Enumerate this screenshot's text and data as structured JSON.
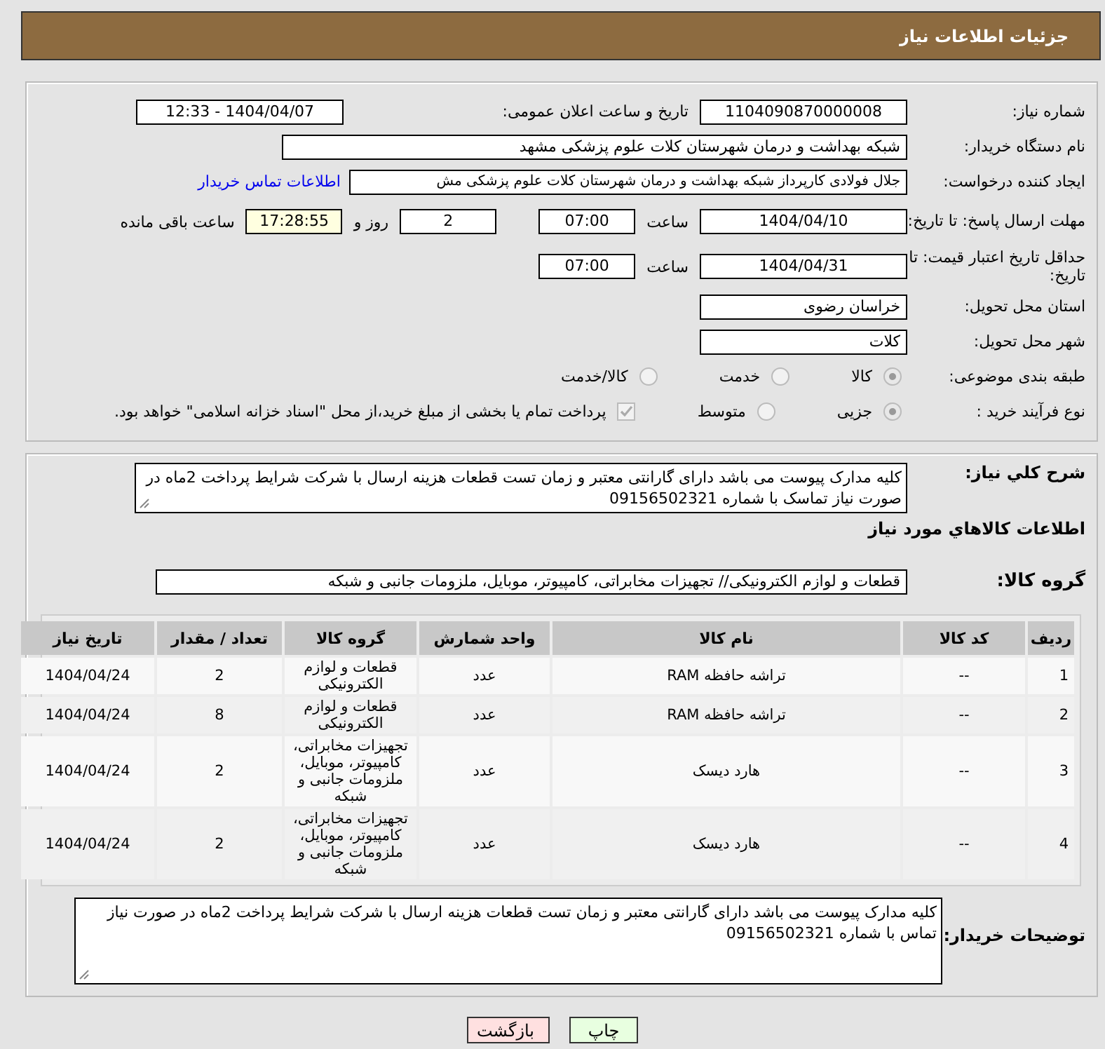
{
  "header": {
    "title": "جزئیات اطلاعات نیاز"
  },
  "fields": {
    "need_number": {
      "label": "شماره نیاز:",
      "value": "1104090870000008"
    },
    "announce": {
      "label": "تاریخ و ساعت اعلان عمومی:",
      "value": "1404/04/07 - 12:33"
    },
    "buyer": {
      "label": "نام دستگاه خریدار:",
      "value": "شبکه بهداشت و درمان شهرستان کلات   علوم پزشکی مشهد"
    },
    "creator": {
      "label": "ایجاد کننده درخواست:",
      "value": "جلال فولادی کارپرداز شبکه بهداشت و درمان شهرستان کلات   علوم پزشکی مش",
      "link": "اطلاعات تماس خریدار"
    },
    "deadline": {
      "label": "مهلت ارسال پاسخ: تا تاریخ:",
      "date": "1404/04/10",
      "time_label": "ساعت",
      "time": "07:00",
      "days": "2",
      "days_label": "روز و",
      "remaining": "17:28:55",
      "remaining_label": "ساعت باقی مانده"
    },
    "validity": {
      "label": "حداقل تاریخ اعتبار قیمت: تا تاریخ:",
      "date": "1404/04/31",
      "time_label": "ساعت",
      "time": "07:00"
    },
    "province": {
      "label": "استان محل تحویل:",
      "value": "خراسان رضوی"
    },
    "city": {
      "label": "شهر محل تحویل:",
      "value": "کلات"
    },
    "category": {
      "label": "طبقه بندی موضوعی:",
      "options": [
        {
          "label": "کالا",
          "selected": true
        },
        {
          "label": "خدمت",
          "selected": false
        },
        {
          "label": "کالا/خدمت",
          "selected": false
        }
      ]
    },
    "purchase": {
      "label": "نوع فرآیند خرید :",
      "options": [
        {
          "label": "جزیی",
          "selected": true
        },
        {
          "label": "متوسط",
          "selected": false
        }
      ],
      "note": {
        "checked": true,
        "text": "پرداخت تمام یا بخشی از مبلغ خرید،از محل \"اسناد خزانه اسلامی\" خواهد بود."
      }
    }
  },
  "description": {
    "label": "شرح کلي نياز:",
    "value": "کلیه مدارک پیوست می باشد دارای گارانتی معتبر و زمان تست قطعات هزینه ارسال با شرکت شرایط پرداخت 2ماه در صورت نیاز تماسک با شماره 09156502321"
  },
  "goods": {
    "title": "اطلاعات کالاهاي مورد نياز",
    "group_label": "گروه کالا:",
    "group": "قطعات و لوازم الکترونیکی// تجهیزات مخابراتی، کامپیوتر، موبایل، ملزومات جانبی و شبکه"
  },
  "table": {
    "columns": [
      "ردیف",
      "کد کالا",
      "نام کالا",
      "واحد شمارش",
      "گروه کالا",
      "تعداد / مقدار",
      "تاریخ نیاز"
    ],
    "rows": [
      [
        "1",
        "--",
        "تراشه حافظه RAM",
        "عدد",
        "قطعات و لوازم الکترونیکی",
        "2",
        "1404/04/24"
      ],
      [
        "2",
        "--",
        "تراشه حافظه RAM",
        "عدد",
        "قطعات و لوازم الکترونیکی",
        "8",
        "1404/04/24"
      ],
      [
        "3",
        "--",
        "هارد دیسک",
        "عدد",
        "تجهیزات مخابراتی، کامپیوتر، موبایل، ملزومات جانبی و شبکه",
        "2",
        "1404/04/24"
      ],
      [
        "4",
        "--",
        "هارد دیسک",
        "عدد",
        "تجهیزات مخابراتی، کامپیوتر، موبایل، ملزومات جانبی و شبکه",
        "2",
        "1404/04/24"
      ]
    ]
  },
  "buyer_notes": {
    "label": "توضیحات خریدار:",
    "value": "کلیه مدارک پیوست می باشد دارای گارانتی معتبر و زمان تست قطعات هزینه ارسال با شرکت شرایط پرداخت 2ماه در صورت نیاز تماس با شماره 09156502321"
  },
  "buttons": [
    {
      "label": "چاپ",
      "kind": "print"
    },
    {
      "label": "بازگشت",
      "kind": "back"
    }
  ]
}
